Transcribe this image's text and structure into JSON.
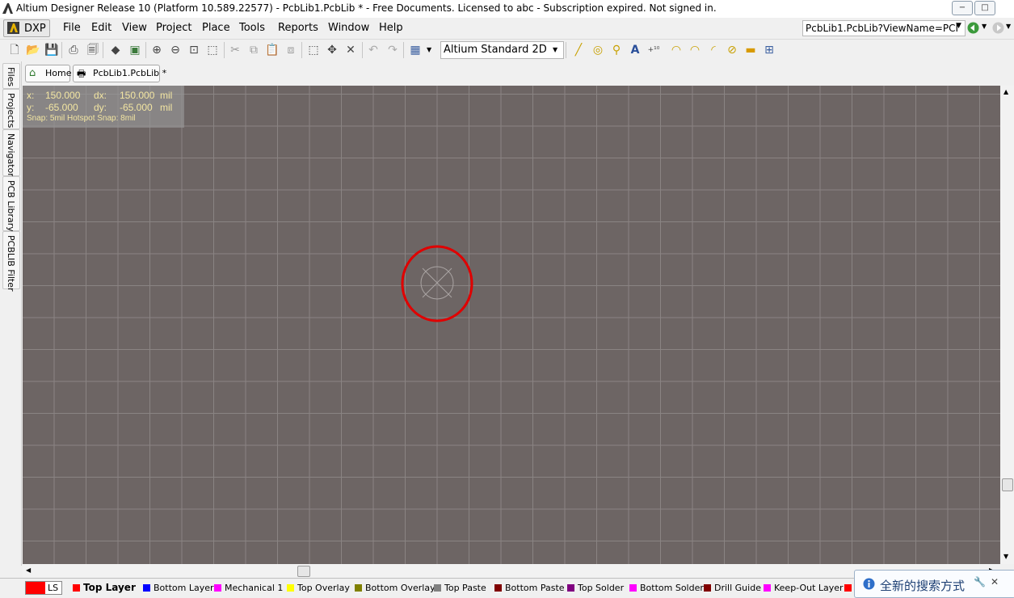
{
  "window": {
    "title": "Altium Designer Release 10 (Platform 10.589.22577) - PcbLib1.PcbLib * - Free Documents. Licensed to abc - Subscription expired. Not signed in.",
    "controls": [
      "−",
      "□"
    ]
  },
  "menubar": {
    "dxp": "DXP",
    "items": [
      "File",
      "Edit",
      "View",
      "Project",
      "Place",
      "Tools",
      "Reports",
      "Window",
      "Help"
    ],
    "address": "PcbLib1.PcbLib?ViewName=PCI"
  },
  "toolbar": {
    "view_mode": "Altium Standard 2D"
  },
  "sidebar": {
    "tabs": [
      "Files",
      "Projects",
      "Navigator",
      "PCB Library",
      "PCBLIB Filter"
    ]
  },
  "doc_tabs": {
    "home": "Home",
    "document": "PcbLib1.PcbLib *"
  },
  "coords": {
    "x_label": "x:",
    "x_value": "150.000",
    "dx_label": "dx:",
    "dx_value": "150.000",
    "unit": "mil",
    "y_label": "y:",
    "y_value": "-65.000",
    "dy_label": "dy:",
    "dy_value": "-65.000",
    "snap": "Snap: 5mil Hotspot Snap: 8mil"
  },
  "layers": {
    "ls": "LS",
    "tabs": [
      {
        "name": "Top Layer",
        "color": "#ff0000",
        "active": true
      },
      {
        "name": "Bottom Layer",
        "color": "#0000ff"
      },
      {
        "name": "Mechanical 1",
        "color": "#ff00ff"
      },
      {
        "name": "Top Overlay",
        "color": "#ffff00"
      },
      {
        "name": "Bottom Overlay",
        "color": "#808000"
      },
      {
        "name": "Top Paste",
        "color": "#808080"
      },
      {
        "name": "Bottom Paste",
        "color": "#800000"
      },
      {
        "name": "Top Solder",
        "color": "#800080"
      },
      {
        "name": "Bottom Solder",
        "color": "#ff00ff"
      },
      {
        "name": "Drill Guide",
        "color": "#800000"
      },
      {
        "name": "Keep-Out Layer",
        "color": "#ff00ff"
      }
    ]
  },
  "notification": {
    "text": "全新的搜索方式"
  },
  "colors": {
    "canvas": "#6d6564",
    "grid": "#8a8483",
    "highlight_circle": "#e00000"
  }
}
